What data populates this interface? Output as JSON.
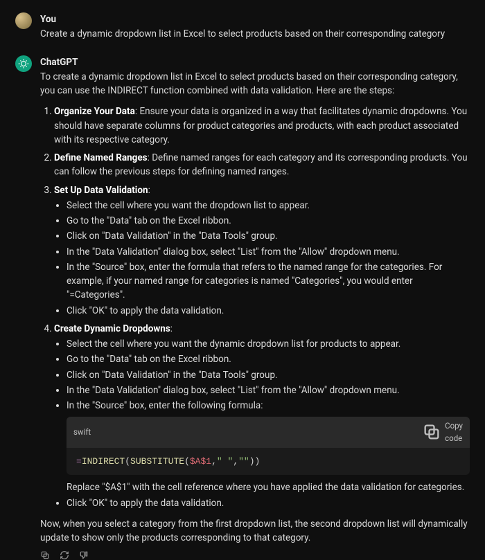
{
  "user": {
    "sender": "You",
    "text": "Create a dynamic dropdown list in Excel to select products based on their corresponding category"
  },
  "bot": {
    "sender": "ChatGPT",
    "intro": "To create a dynamic dropdown list in Excel to select products based on their corresponding category, you can use the INDIRECT function combined with data validation. Here are the steps:",
    "step1": {
      "title": "Organize Your Data",
      "body": ": Ensure your data is organized in a way that facilitates dynamic dropdowns. You should have separate columns for product categories and products, with each product associated with its respective category."
    },
    "step2": {
      "title": "Define Named Ranges",
      "body": ": Define named ranges for each category and its corresponding products. You can follow the previous steps for defining named ranges."
    },
    "step3": {
      "title": "Set Up Data Validation",
      "body": ":",
      "b1": "Select the cell where you want the dropdown list to appear.",
      "b2": "Go to the \"Data\" tab on the Excel ribbon.",
      "b3": "Click on \"Data Validation\" in the \"Data Tools\" group.",
      "b4": "In the \"Data Validation\" dialog box, select \"List\" from the \"Allow\" dropdown menu.",
      "b5": "In the \"Source\" box, enter the formula that refers to the named range for the categories. For example, if your named range for categories is named \"Categories\", you would enter \"=Categories\".",
      "b6": "Click \"OK\" to apply the data validation."
    },
    "step4": {
      "title": "Create Dynamic Dropdowns",
      "body": ":",
      "b1": "Select the cell where you want the dynamic dropdown list for products to appear.",
      "b2": "Go to the \"Data\" tab on the Excel ribbon.",
      "b3": "Click on \"Data Validation\" in the \"Data Tools\" group.",
      "b4": "In the \"Data Validation\" dialog box, select \"List\" from the \"Allow\" dropdown menu.",
      "b5": "In the \"Source\" box, enter the following formula:",
      "after": "Replace \"$A$1\" with the cell reference where you have applied the data validation for categories.",
      "b6": "Click \"OK\" to apply the data validation."
    },
    "code": {
      "lang": "swift",
      "copy": "Copy code",
      "eq": "=",
      "fn1": "INDIRECT",
      "p1": "(",
      "fn2": "SUBSTITUTE",
      "p2": "(",
      "var": "$A$1",
      "c1": ",",
      "s1": "\" \"",
      "c2": ",",
      "s2": "\"\"",
      "p3": ")",
      "p4": ")"
    },
    "outro": "Now, when you select a category from the first dropdown list, the second dropdown list will dynamically update to show only the products corresponding to that category."
  }
}
